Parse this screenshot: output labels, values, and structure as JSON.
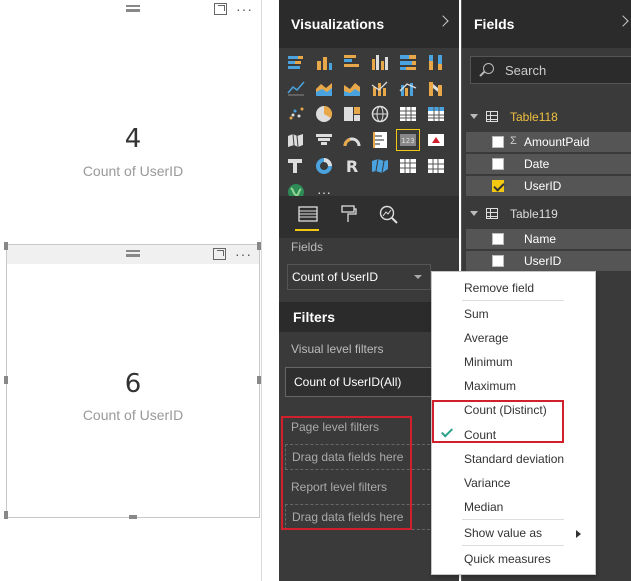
{
  "canvas": {
    "card1": {
      "value": "4",
      "label": "Count of UserID"
    },
    "card2": {
      "value": "6",
      "label": "Count of UserID"
    },
    "more_glyph": "···"
  },
  "visualizations": {
    "title": "Visualizations",
    "more_glyph": "···",
    "fields_label": "Fields",
    "field_well_value": "Count of UserID",
    "filters_title": "Filters",
    "visual_level_label": "Visual level filters",
    "filter_chip": "Count of UserID(All)",
    "page_level_label": "Page level filters",
    "drag_here_1": "Drag data fields here",
    "report_level_label": "Report level filters",
    "drag_here_2": "Drag data fields here",
    "icons": [
      "stacked-bar-icon",
      "stacked-column-icon",
      "clustered-bar-icon",
      "clustered-column-icon",
      "100-stacked-bar-icon",
      "100-stacked-column-icon",
      "line-chart-icon",
      "area-chart-icon",
      "stacked-area-icon",
      "line-column-icon",
      "line-clustered-column-icon",
      "ribbon-chart-icon",
      "scatter-icon",
      "pie-chart-icon",
      "treemap-icon",
      "map-icon",
      "table-icon",
      "matrix-icon",
      "filled-map-icon",
      "funnel-icon",
      "gauge-icon",
      "multi-row-card-icon",
      "card-icon",
      "kpi-icon",
      "slicer-icon",
      "donut-icon",
      "r-visual-icon",
      "shape-map-icon",
      "table-grid-icon",
      "waterfall-icon",
      "globe-icon",
      "more-icon"
    ]
  },
  "fields_pane": {
    "title": "Fields",
    "search_placeholder": "Search",
    "tables": [
      {
        "name": "Table118",
        "fields": [
          {
            "name": "AmountPaid",
            "checked": false,
            "sigma": true
          },
          {
            "name": "Date",
            "checked": false,
            "sigma": false
          },
          {
            "name": "UserID",
            "checked": true,
            "sigma": false
          }
        ]
      },
      {
        "name": "Table119",
        "fields": [
          {
            "name": "Name",
            "checked": false,
            "sigma": false
          },
          {
            "name": "UserID",
            "checked": false,
            "sigma": false
          }
        ]
      }
    ],
    "sigma_glyph": "Σ"
  },
  "context_menu": {
    "items": [
      "Remove field",
      "Sum",
      "Average",
      "Minimum",
      "Maximum",
      "Count (Distinct)",
      "Count",
      "Standard deviation",
      "Variance",
      "Median",
      "Show value as",
      "Quick measures"
    ],
    "checked_item": "Count"
  },
  "colors": {
    "accent": "#f2c811",
    "highlight_box": "#d1202c",
    "check": "#2ba18a",
    "pane_bg": "#3a3a3a"
  }
}
